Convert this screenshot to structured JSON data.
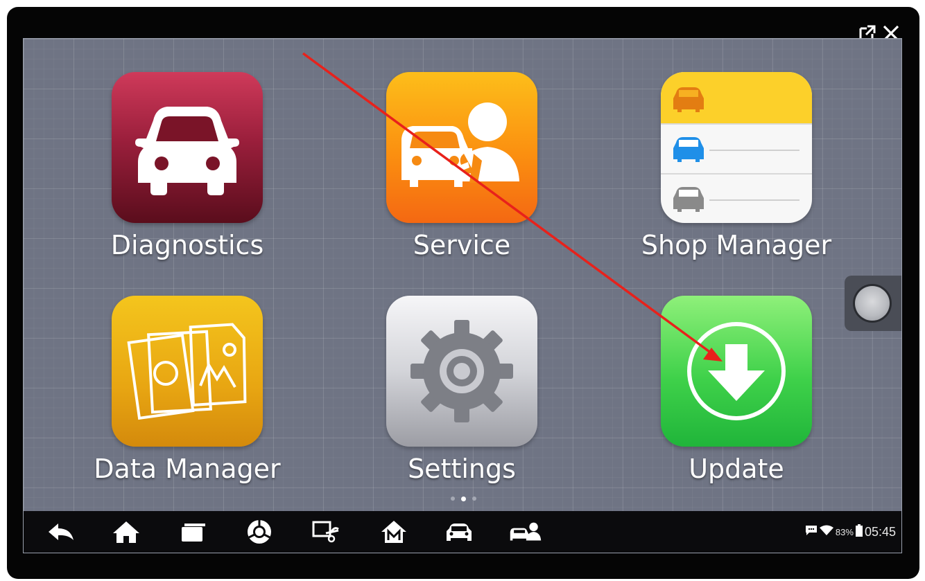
{
  "window": {
    "controls": [
      {
        "name": "popout-icon"
      },
      {
        "name": "close-icon"
      }
    ]
  },
  "apps": [
    {
      "label": "Diagnostics",
      "icon": "car-front-icon"
    },
    {
      "label": "Service",
      "icon": "car-mechanic-icon"
    },
    {
      "label": "Shop Manager",
      "icon": "car-list-icon"
    },
    {
      "label": "Data Manager",
      "icon": "photo-files-icon"
    },
    {
      "label": "Settings",
      "icon": "gear-icon"
    },
    {
      "label": "Update",
      "icon": "download-arrow-icon"
    }
  ],
  "pager": {
    "pages": 3,
    "active": 2
  },
  "navbar": {
    "buttons": [
      "back-icon",
      "home-icon",
      "recent-apps-icon",
      "browser-icon",
      "screenshot-icon",
      "m-home-icon",
      "vehicle-icon",
      "service-tech-icon"
    ]
  },
  "status": {
    "battery": "83%",
    "time": "05:45",
    "icons": [
      "message-icon",
      "wifi-icon",
      "battery-icon"
    ]
  },
  "annotation": {
    "type": "red-arrow",
    "color": "#e8211b",
    "target": "Update"
  },
  "colors": {
    "diagnostics": "#9b1f3c",
    "service": "#fb8f10",
    "shop_manager_header": "#fcd02a",
    "data_manager": "#e8a612",
    "settings": "#c9cad0",
    "update": "#3fd14a",
    "screen_bg": "#6f7484"
  }
}
